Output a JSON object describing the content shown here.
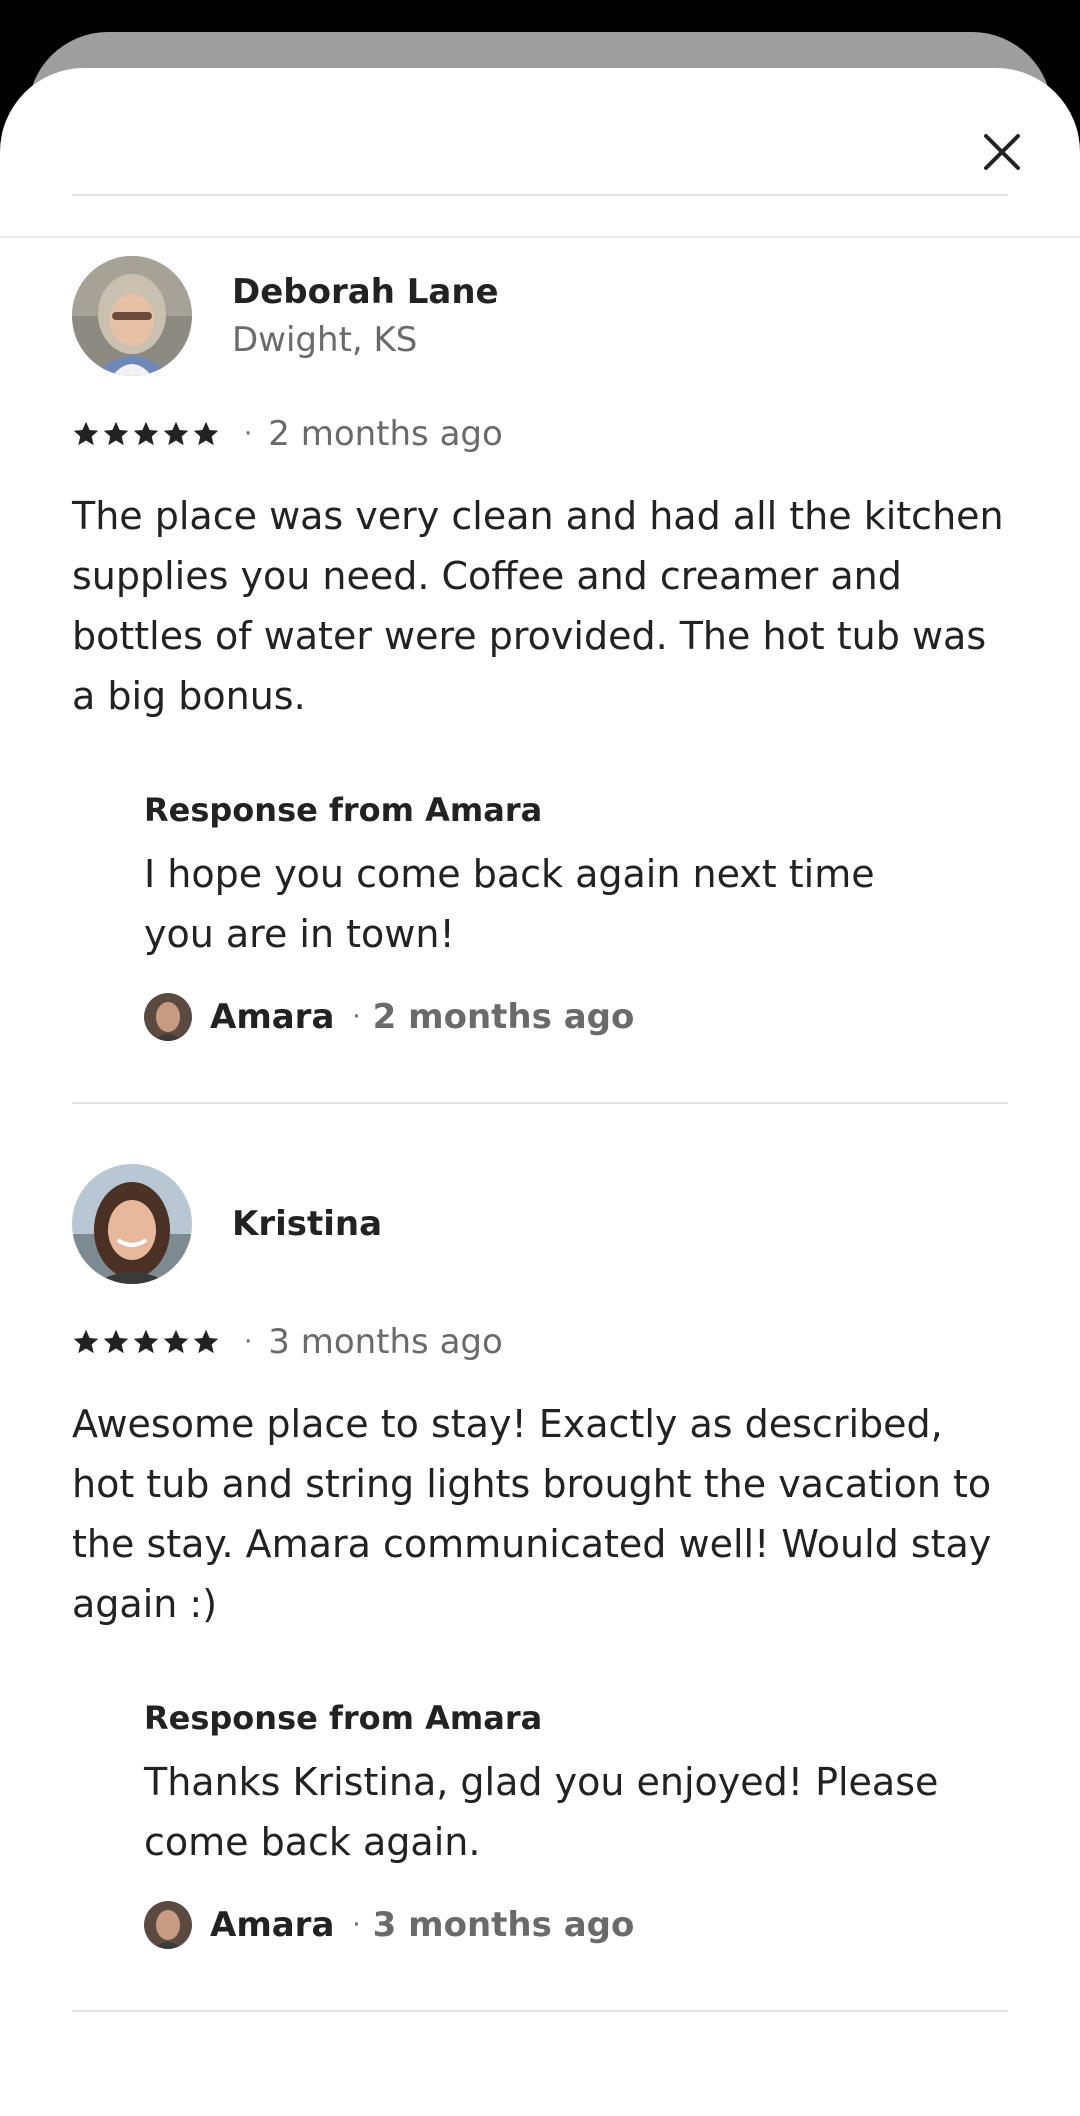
{
  "sheet": {
    "close_icon": "close-icon"
  },
  "reviews": [
    {
      "name": "Deborah Lane",
      "location": "Dwight, KS",
      "rating": 5,
      "date": "2 months ago",
      "text": "The place was very clean and had all the kitchen supplies you need.  Coffee and creamer and bottles of water were provided.  The hot tub was a big bonus.",
      "response": {
        "title": "Response from Amara",
        "text": "I hope you come back again next time you are in town!",
        "host_name": "Amara",
        "date": "2 months ago"
      }
    },
    {
      "name": "Kristina",
      "location": "",
      "rating": 5,
      "date": "3 months ago",
      "text": "Awesome place to stay! Exactly as described, hot tub and string lights brought the vacation to the stay. Amara communicated well! Would stay again :)",
      "response": {
        "title": "Response from Amara",
        "text": "Thanks Kristina, glad you enjoyed! Please come back again.",
        "host_name": "Amara",
        "date": "3 months ago"
      }
    }
  ],
  "separator": "·"
}
